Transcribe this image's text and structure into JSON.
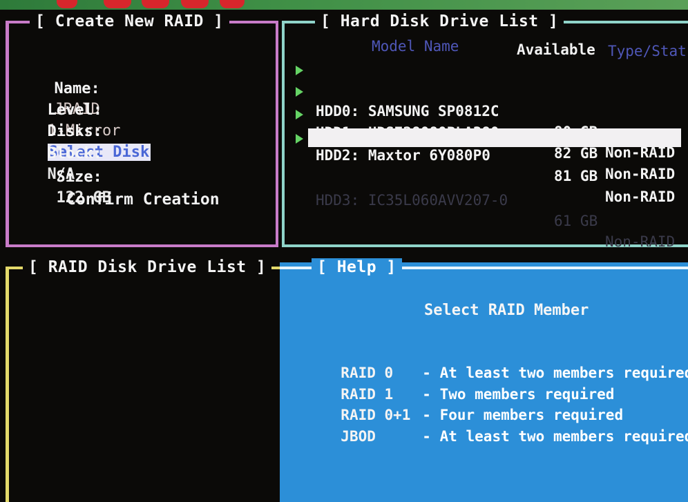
{
  "colors": {
    "create_border": "#c87bc8",
    "hdd_border": "#8fd3c9",
    "raid_border": "#e3d96a",
    "help_bg": "#2c8fd8",
    "arrow": "#65d365"
  },
  "create_panel": {
    "title": "[ Create New RAID ]",
    "fields": [
      {
        "label": "Name:",
        "value": "JRAID"
      },
      {
        "label": "Level:",
        "value": "1-Mirror"
      },
      {
        "label": "Disks:",
        "value": "Select Disk"
      },
      {
        "label": "Block:",
        "value": "N/A"
      },
      {
        "label": "Size:",
        "value": "122 GB"
      }
    ],
    "confirm_label": "Confirm Creation"
  },
  "hdd_panel": {
    "title": "[ Hard Disk Drive List ]",
    "columns": {
      "model": "Model Name",
      "available": "Available",
      "type": "Type/Stat"
    },
    "arrow_icon": "triangle-right-icon",
    "rows": [
      {
        "name": "HDD0: SAMSUNG SP0812C",
        "available": "80 GB",
        "type": "Non-RAID"
      },
      {
        "name": "HDD1: HDS728080PLA380",
        "available": "82 GB",
        "type": "Non-RAID"
      },
      {
        "name": "HDD2: Maxtor 6Y080P0",
        "available": "81 GB",
        "type": "Non-RAID"
      },
      {
        "name": "HDD3: IC35L060AVV207-0",
        "available": "61 GB",
        "type": "Non-RAID"
      }
    ]
  },
  "raid_panel": {
    "title": "[ RAID Disk Drive List ]"
  },
  "help_panel": {
    "title": "[ Help ]",
    "heading": "Select RAID Member",
    "rows": [
      {
        "level": "RAID 0",
        "desc": "- At least two members required"
      },
      {
        "level": "RAID 1",
        "desc": "- Two members required"
      },
      {
        "level": "RAID 0+1",
        "desc": "- Four members required"
      },
      {
        "level": "JBOD",
        "desc": "- At least two members required"
      }
    ]
  }
}
